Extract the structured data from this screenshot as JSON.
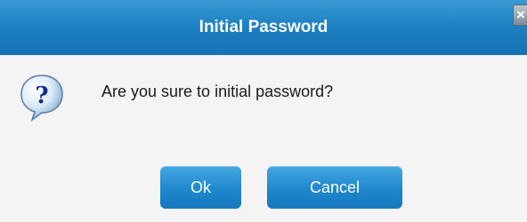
{
  "dialog": {
    "title": "Initial Password",
    "close_glyph": "×",
    "message": "Are you sure to initial password?",
    "icon": "question-icon",
    "buttons": {
      "ok_label": "Ok",
      "cancel_label": "Cancel"
    }
  },
  "colors": {
    "titlebar": "#1d7fc1",
    "button": "#1f87cc",
    "background": "#f4f4f4"
  }
}
